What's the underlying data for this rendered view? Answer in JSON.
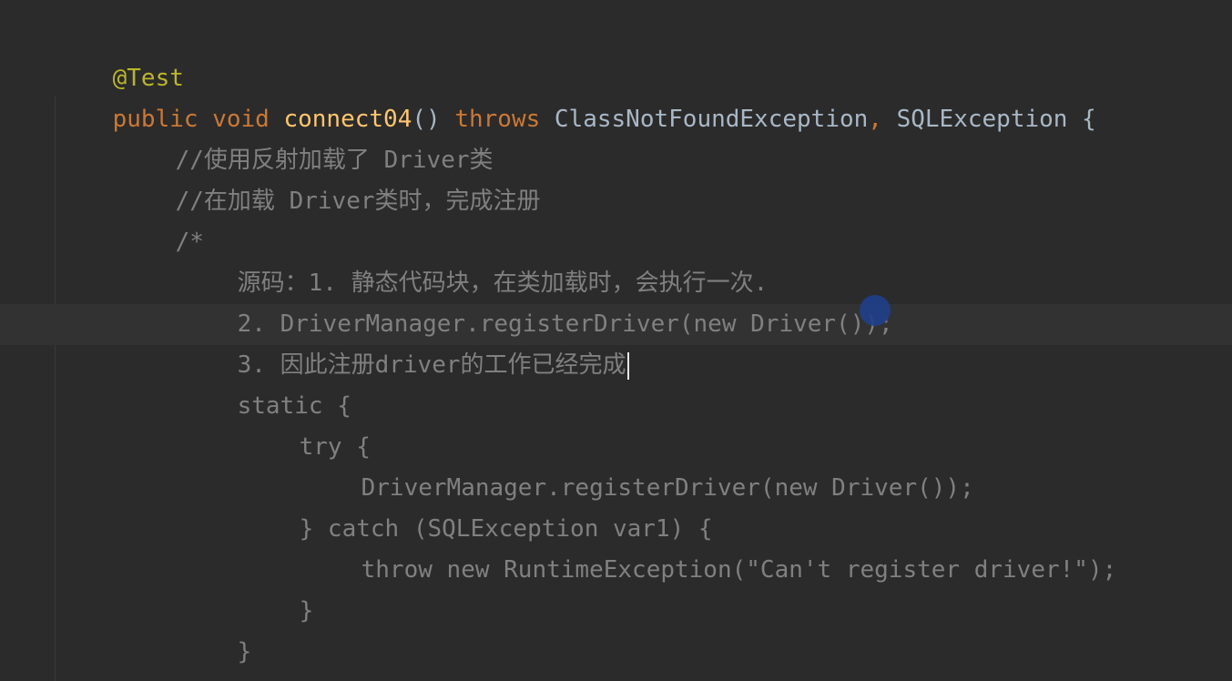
{
  "editor": {
    "colors": {
      "background": "#2b2b2b",
      "current_line": "#323232",
      "annotation": "#bbb529",
      "keyword": "#cc7832",
      "method": "#ffc66d",
      "plain": "#a9b7c6",
      "comment": "#808080"
    },
    "lines": [
      {
        "t0": "@Test"
      },
      {
        "t0": "public void ",
        "t1": "connect04",
        "t2": "() ",
        "t3": "throws ",
        "t4": "ClassNotFoundException",
        "t5": ", ",
        "t6": "SQLException {"
      },
      {
        "t0": "//使用反射加载了 Driver类"
      },
      {
        "t0": "//在加载 Driver类时，完成注册"
      },
      {
        "t0": "/*"
      },
      {
        "t0": "源码：1. 静态代码块，在类加载时，会执行一次."
      },
      {
        "t0": "2. DriverManager.registerDriver(new Driver());"
      },
      {
        "t0": "3. 因此注册driver的工作已经完成"
      },
      {
        "t0": "static {"
      },
      {
        "t0": "try {"
      },
      {
        "t0": "DriverManager.registerDriver(new Driver());"
      },
      {
        "t0": "} catch (SQLException var1) {"
      },
      {
        "t0": "throw new RuntimeException(\"Can't register driver!\");"
      },
      {
        "t0": "}"
      },
      {
        "t0": "}"
      },
      {
        "t0": "*/"
      }
    ]
  }
}
